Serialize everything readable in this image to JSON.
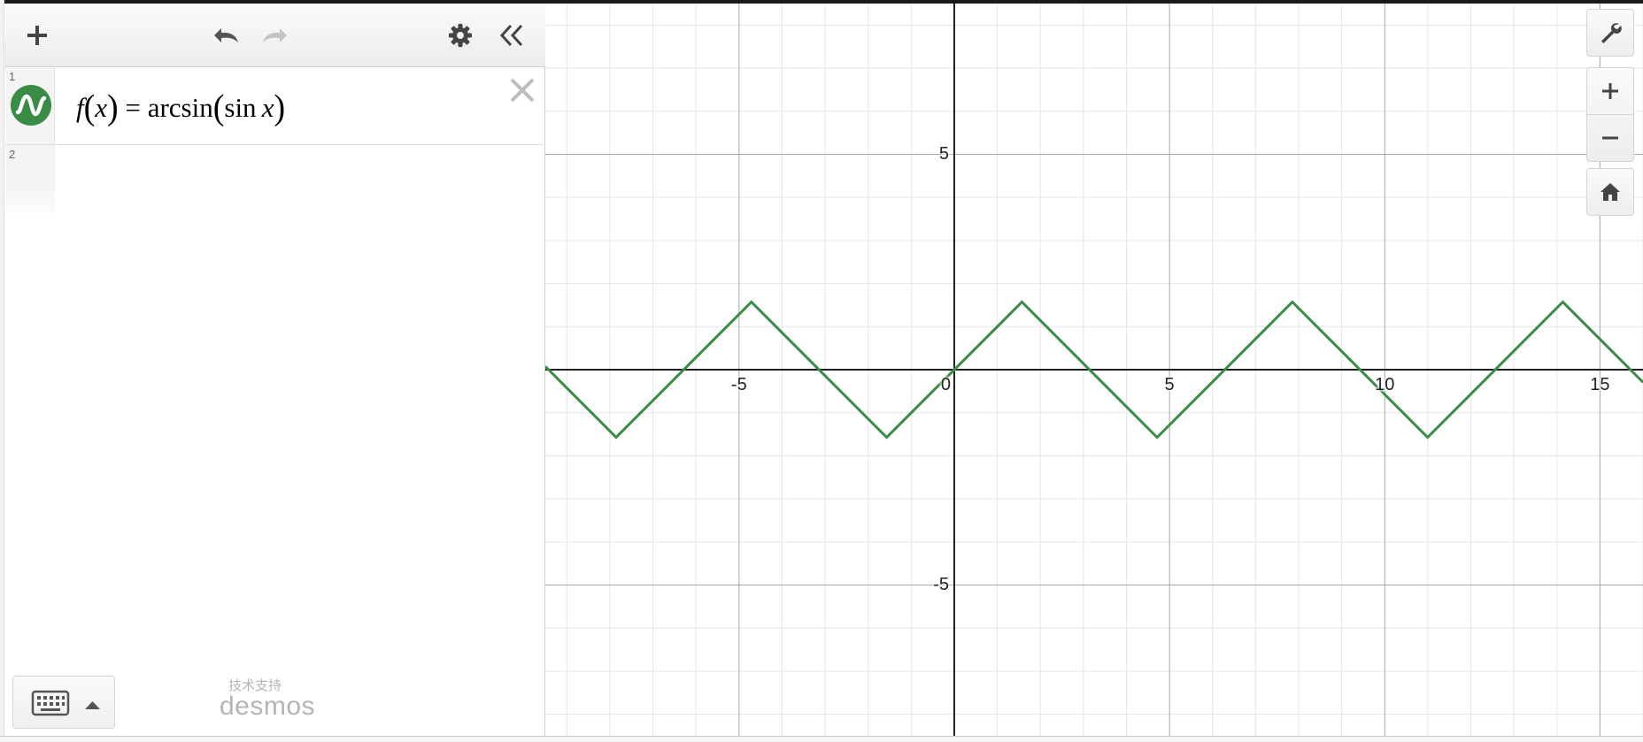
{
  "toolbar": {
    "add_icon": "plus-icon",
    "undo_icon": "undo-icon",
    "redo_icon": "redo-icon",
    "settings_icon": "gear-icon",
    "collapse_icon": "double-chevron-left-icon"
  },
  "expressions": [
    {
      "index": "1",
      "color": "#388c46",
      "latex": "f(x) = arcsin(sin x)",
      "parts": {
        "fname": "f",
        "arg": "x",
        "equals": " = ",
        "func": "arcsin",
        "inner_func": "sin",
        "inner_arg": "x"
      }
    },
    {
      "index": "2",
      "latex": ""
    }
  ],
  "footer": {
    "keyboard_icon": "keyboard-icon",
    "powered_by": "技术支持",
    "brand": "desmos"
  },
  "graph_controls": {
    "settings_icon": "wrench-icon",
    "zoom_in_icon": "plus-icon",
    "zoom_out_icon": "minus-icon",
    "home_icon": "home-icon"
  },
  "chart_data": {
    "type": "line",
    "xlim": [
      -9.5,
      16.0
    ],
    "ylim": [
      -8.5,
      8.5
    ],
    "grid": true,
    "minor_step": 1,
    "major_step": 5,
    "x_ticks": [
      "-5",
      "0",
      "5",
      "10",
      "15"
    ],
    "y_ticks": [
      "5",
      "-5"
    ],
    "series": [
      {
        "function": "f(x) = arcsin(sin x)",
        "color": "#388c46",
        "x": [
          -9.5,
          -7.854,
          -4.712,
          -1.571,
          1.571,
          4.712,
          7.854,
          10.996,
          14.137,
          16.0
        ],
        "y": [
          0.075,
          -1.571,
          1.571,
          -1.571,
          1.571,
          -1.571,
          1.571,
          -1.571,
          1.571,
          -0.292
        ]
      }
    ]
  }
}
